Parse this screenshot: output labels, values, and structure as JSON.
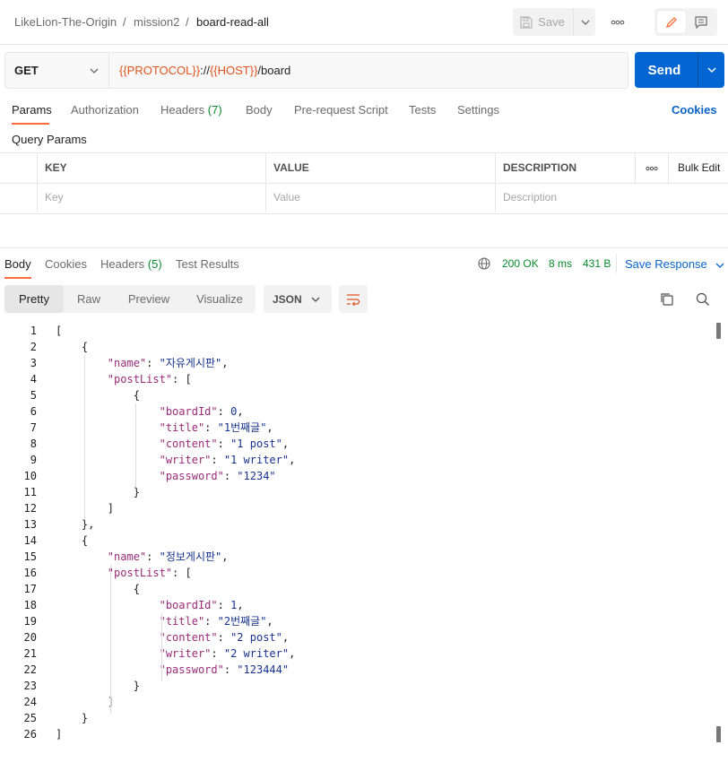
{
  "breadcrumb": {
    "workspace": "LikeLion-The-Origin",
    "collection": "mission2",
    "request": "board-read-all",
    "sep": "/"
  },
  "toolbar": {
    "save_label": "Save"
  },
  "request": {
    "method": "GET",
    "url_parts": [
      {
        "text": "{{PROTOCOL}}",
        "var": true
      },
      {
        "text": "://",
        "var": false
      },
      {
        "text": "{{HOST}}",
        "var": true
      },
      {
        "text": "/board",
        "var": false
      }
    ],
    "send_label": "Send"
  },
  "request_tabs": [
    {
      "label": "Params",
      "active": true
    },
    {
      "label": "Authorization"
    },
    {
      "label": "Headers",
      "count": "(7)"
    },
    {
      "label": "Body"
    },
    {
      "label": "Pre-request Script"
    },
    {
      "label": "Tests"
    },
    {
      "label": "Settings"
    }
  ],
  "cookies_label": "Cookies",
  "query_params": {
    "title": "Query Params",
    "headers": {
      "key": "KEY",
      "value": "VALUE",
      "description": "DESCRIPTION",
      "bulk": "Bulk Edit"
    },
    "placeholders": {
      "key": "Key",
      "value": "Value",
      "description": "Description"
    }
  },
  "response_tabs": [
    {
      "label": "Body",
      "active": true
    },
    {
      "label": "Cookies"
    },
    {
      "label": "Headers",
      "count": "(5)"
    },
    {
      "label": "Test Results"
    }
  ],
  "status": {
    "code": "200 OK",
    "time": "8 ms",
    "size": "431 B",
    "save_response": "Save Response"
  },
  "view_modes": [
    "Pretty",
    "Raw",
    "Preview",
    "Visualize"
  ],
  "format": "JSON",
  "colors": {
    "accent": "#ff6c37",
    "send": "#0265d2",
    "link": "#0b63c9",
    "ok": "#0a8a2e",
    "variable": "#e05320"
  },
  "code_lines": [
    "[",
    "    {",
    "        \"name\": \"자유게시판\",",
    "        \"postList\": [",
    "            {",
    "                \"boardId\": 0,",
    "                \"title\": \"1번째글\",",
    "                \"content\": \"1 post\",",
    "                \"writer\": \"1 writer\",",
    "                \"password\": \"1234\"",
    "            }",
    "        ]",
    "    },",
    "    {",
    "        \"name\": \"정보게시판\",",
    "        \"postList\": [",
    "            {",
    "                \"boardId\": 1,",
    "                \"title\": \"2번째글\",",
    "                \"content\": \"2 post\",",
    "                \"writer\": \"2 writer\",",
    "                \"password\": \"123444\"",
    "            }",
    "        ]",
    "    }",
    "]"
  ]
}
